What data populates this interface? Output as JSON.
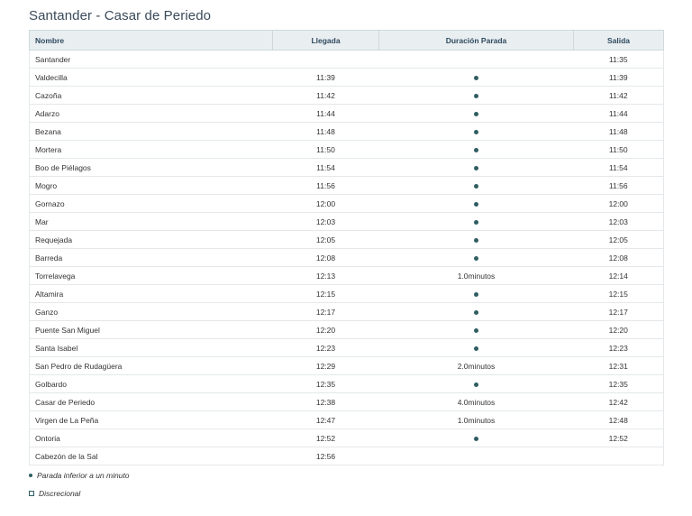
{
  "page": {
    "title": "Santander - Casar de Periedo"
  },
  "table": {
    "headers": {
      "name": "Nombre",
      "arrival": "Llegada",
      "duration": "Duración Parada",
      "departure": "Salida"
    },
    "rows": [
      {
        "name": "Santander",
        "arrival": "",
        "duration": "",
        "departure": "11:35"
      },
      {
        "name": "Valdecilla",
        "arrival": "11:39",
        "duration": "dot",
        "departure": "11:39"
      },
      {
        "name": "Cazoña",
        "arrival": "11:42",
        "duration": "dot",
        "departure": "11:42"
      },
      {
        "name": "Adarzo",
        "arrival": "11:44",
        "duration": "dot",
        "departure": "11:44"
      },
      {
        "name": "Bezana",
        "arrival": "11:48",
        "duration": "dot",
        "departure": "11:48"
      },
      {
        "name": "Mortera",
        "arrival": "11:50",
        "duration": "dot",
        "departure": "11:50"
      },
      {
        "name": "Boo de Piélagos",
        "arrival": "11:54",
        "duration": "dot",
        "departure": "11:54"
      },
      {
        "name": "Mogro",
        "arrival": "11:56",
        "duration": "dot",
        "departure": "11:56"
      },
      {
        "name": "Gornazo",
        "arrival": "12:00",
        "duration": "dot",
        "departure": "12:00"
      },
      {
        "name": "Mar",
        "arrival": "12:03",
        "duration": "dot",
        "departure": "12:03"
      },
      {
        "name": "Requejada",
        "arrival": "12:05",
        "duration": "dot",
        "departure": "12:05"
      },
      {
        "name": "Barreda",
        "arrival": "12:08",
        "duration": "dot",
        "departure": "12:08"
      },
      {
        "name": "Torrelavega",
        "arrival": "12:13",
        "duration": "1.0minutos",
        "departure": "12:14"
      },
      {
        "name": "Altamira",
        "arrival": "12:15",
        "duration": "dot",
        "departure": "12:15"
      },
      {
        "name": "Ganzo",
        "arrival": "12:17",
        "duration": "dot",
        "departure": "12:17"
      },
      {
        "name": "Puente San Miguel",
        "arrival": "12:20",
        "duration": "dot",
        "departure": "12:20"
      },
      {
        "name": "Santa Isabel",
        "arrival": "12:23",
        "duration": "dot",
        "departure": "12:23"
      },
      {
        "name": "San Pedro de Rudagüera",
        "arrival": "12:29",
        "duration": "2.0minutos",
        "departure": "12:31"
      },
      {
        "name": "Golbardo",
        "arrival": "12:35",
        "duration": "dot",
        "departure": "12:35"
      },
      {
        "name": "Casar de Periedo",
        "arrival": "12:38",
        "duration": "4.0minutos",
        "departure": "12:42"
      },
      {
        "name": "Virgen de La Peña",
        "arrival": "12:47",
        "duration": "1.0minutos",
        "departure": "12:48"
      },
      {
        "name": "Ontoria",
        "arrival": "12:52",
        "duration": "dot",
        "departure": "12:52"
      },
      {
        "name": "Cabezón de la Sal",
        "arrival": "12:56",
        "duration": "",
        "departure": ""
      }
    ]
  },
  "legend": {
    "dot_label": "Parada inferior a un minuto",
    "square_label": "Discrecional"
  },
  "colors": {
    "accent": "#2f5d62",
    "header_bg": "#e9eef1",
    "header_text": "#2e4a5e"
  }
}
